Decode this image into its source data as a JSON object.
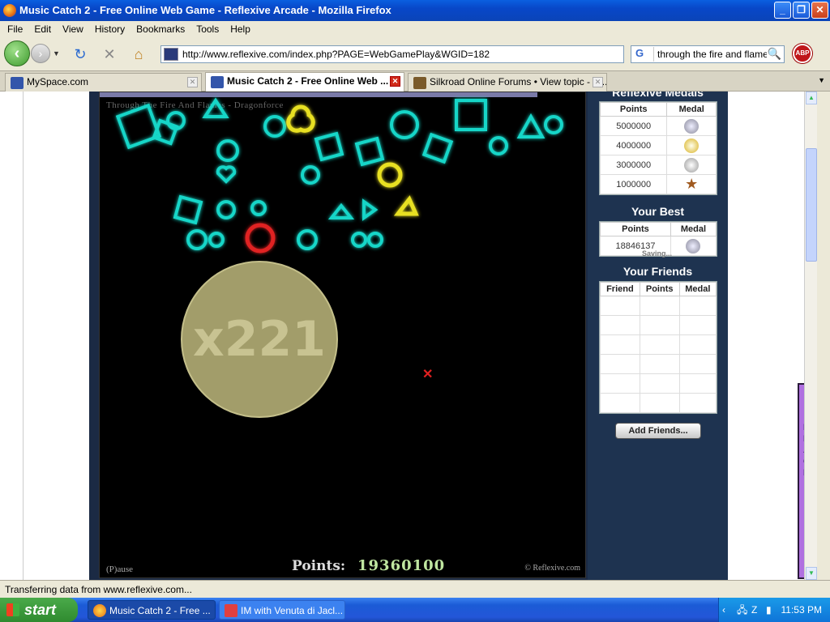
{
  "window": {
    "title": "Music Catch 2 - Free Online Web Game - Reflexive Arcade - Mozilla Firefox"
  },
  "menu": [
    "File",
    "Edit",
    "View",
    "History",
    "Bookmarks",
    "Tools",
    "Help"
  ],
  "url": "http://www.reflexive.com/index.php?PAGE=WebGamePlay&WGID=182",
  "search": {
    "value": "through the fire and flames",
    "engine": "G"
  },
  "tabs": [
    {
      "label": "MySpace.com",
      "active": false
    },
    {
      "label": "Music Catch 2 - Free Online Web ...",
      "active": true
    },
    {
      "label": "Silkroad Online Forums • View topic - w...",
      "active": false
    }
  ],
  "game": {
    "song": "Through The Fire And Flames - Dragonforce",
    "multiplier": "x221",
    "pause_label": "(P)ause",
    "points_label": "Points:",
    "points_value": "19360100",
    "copyright": "© Reflexive.com"
  },
  "side": {
    "medals_title": "Reflexive Medals",
    "medals_headers": [
      "Points",
      "Medal"
    ],
    "medals": [
      {
        "points": "5000000",
        "medal": "platinum"
      },
      {
        "points": "4000000",
        "medal": "gold"
      },
      {
        "points": "3000000",
        "medal": "silver"
      },
      {
        "points": "1000000",
        "medal": "bronze"
      }
    ],
    "best_title": "Your Best",
    "best_headers": [
      "Points",
      "Medal"
    ],
    "best_points": "18846137",
    "best_saving": "Saving...",
    "friends_title": "Your Friends",
    "friends_headers": [
      "Friend",
      "Points",
      "Medal"
    ],
    "add_friends": "Add Friends..."
  },
  "feedback": "FEEDBACK <",
  "status": "Transferring data from www.reflexive.com...",
  "taskbar": {
    "start": "start",
    "items": [
      "Music Catch 2 - Free ...",
      "IM with Venuta di Jacl..."
    ],
    "clock": "11:53 PM"
  },
  "colors": {
    "game_shape_cyan": "#19d6c8",
    "game_shape_yellow": "#e8e020",
    "side_panel": "#1e3350",
    "feedback_tab": "#b070e0"
  }
}
